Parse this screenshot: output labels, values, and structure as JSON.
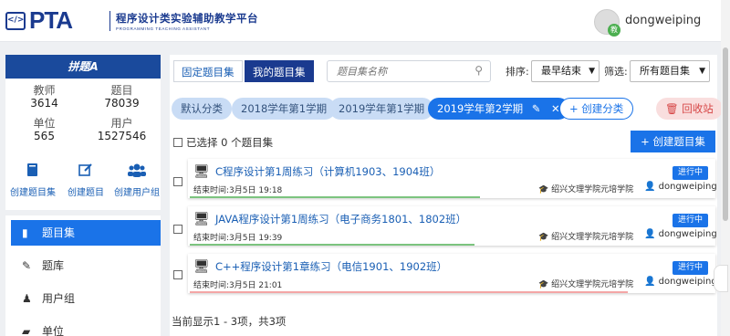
{
  "header": {
    "logo": "PTA",
    "logo_icon": "</>",
    "brand_title": "程序设计类实验辅助教学平台",
    "brand_subtitle": "PROGRAMMING TEACHING ASSISTANT",
    "username": "dongweiping",
    "avatar_badge": "教"
  },
  "sidebar": {
    "banner": "拼题A",
    "stats": [
      {
        "label": "教师",
        "value": "3614"
      },
      {
        "label": "题目",
        "value": "78039"
      },
      {
        "label": "单位",
        "value": "565"
      },
      {
        "label": "用户",
        "value": "1527546"
      }
    ],
    "quick_actions": [
      {
        "label": "创建题目集",
        "icon": "book-icon"
      },
      {
        "label": "创建题目",
        "icon": "edit-icon"
      },
      {
        "label": "创建用户组",
        "icon": "users-icon"
      }
    ],
    "nav": [
      {
        "label": "题目集",
        "icon": "book-icon",
        "active": true
      },
      {
        "label": "题库",
        "icon": "edit-icon",
        "active": false
      },
      {
        "label": "用户组",
        "icon": "users-icon",
        "active": false
      },
      {
        "label": "单位",
        "icon": "briefcase-icon",
        "active": false
      }
    ]
  },
  "main": {
    "tabs": [
      {
        "label": "固定题目集",
        "active": false
      },
      {
        "label": "我的题目集",
        "active": true
      }
    ],
    "search_placeholder": "题目集名称",
    "sort_label": "排序:",
    "sort_value": "最早结束",
    "filter_label": "筛选:",
    "filter_value": "所有题目集",
    "chips": [
      {
        "label": "默认分类",
        "active": false
      },
      {
        "label": "2018学年第1学期",
        "active": false
      },
      {
        "label": "2019学年第1学期",
        "active": false
      },
      {
        "label": "2019学年第2学期",
        "active": true
      }
    ],
    "create_category": "创建分类",
    "recycle_bin": "回收站",
    "selected_text": "已选择 0 个题目集",
    "create_set_button": "创建题目集",
    "rows": [
      {
        "title": "C程序设计第1周练习（计算机1903、1904班）",
        "time": "结束时间:3月5日 19:18",
        "status": "进行中",
        "school": "绍兴文理学院元培学院",
        "owner": "dongweiping",
        "progress_color": "#7cc47f",
        "progress": 0.55
      },
      {
        "title": "JAVA程序设计第1周练习（电子商务1801、1802班）",
        "time": "结束时间:3月5日 19:39",
        "status": "进行中",
        "school": "绍兴文理学院元培学院",
        "owner": "dongweiping",
        "progress_color": "#7cc47f",
        "progress": 0.54
      },
      {
        "title": "C++程序设计第1章练习（电信1901、1902班）",
        "time": "结束时间:3月5日 21:01",
        "status": "进行中",
        "school": "绍兴文理学院元培学院",
        "owner": "dongweiping",
        "progress_color": "#f4a6a6",
        "progress": 0.83
      }
    ],
    "page_info": "当前显示1 - 3项，共3项"
  },
  "colors": {
    "primary": "#1a73e8",
    "brand": "#1a3a8f",
    "chip_bg": "#c9dcf5",
    "danger": "#d64545"
  }
}
